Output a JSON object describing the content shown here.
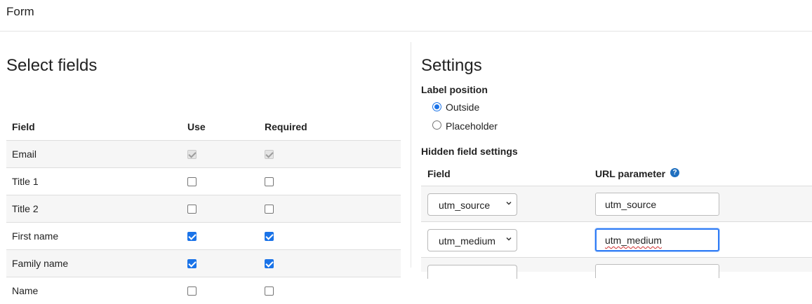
{
  "page": {
    "title": "Form"
  },
  "select_fields": {
    "heading": "Select fields",
    "columns": [
      "Field",
      "Use",
      "Required"
    ],
    "rows": [
      {
        "label": "Email",
        "use": true,
        "required": true,
        "disabled": true
      },
      {
        "label": "Title 1",
        "use": false,
        "required": false,
        "disabled": false
      },
      {
        "label": "Title 2",
        "use": false,
        "required": false,
        "disabled": false
      },
      {
        "label": "First name",
        "use": true,
        "required": true,
        "disabled": false
      },
      {
        "label": "Family name",
        "use": true,
        "required": true,
        "disabled": false
      },
      {
        "label": "Name",
        "use": false,
        "required": false,
        "disabled": false
      }
    ]
  },
  "settings": {
    "heading": "Settings",
    "label_position": {
      "label": "Label position",
      "options": [
        "Outside",
        "Placeholder"
      ],
      "selected": "Outside"
    },
    "hidden_fields": {
      "label": "Hidden field settings",
      "columns": [
        "Field",
        "URL parameter"
      ],
      "rows": [
        {
          "field": "utm_source",
          "param": "utm_source"
        },
        {
          "field": "utm_medium",
          "param": "utm_medium"
        }
      ]
    }
  },
  "colors": {
    "accent": "#1a73e8",
    "help_icon": "#1f6fbf"
  },
  "icons": {
    "help": "question-circle-icon",
    "select_arrow": "chevron-down-icon"
  }
}
